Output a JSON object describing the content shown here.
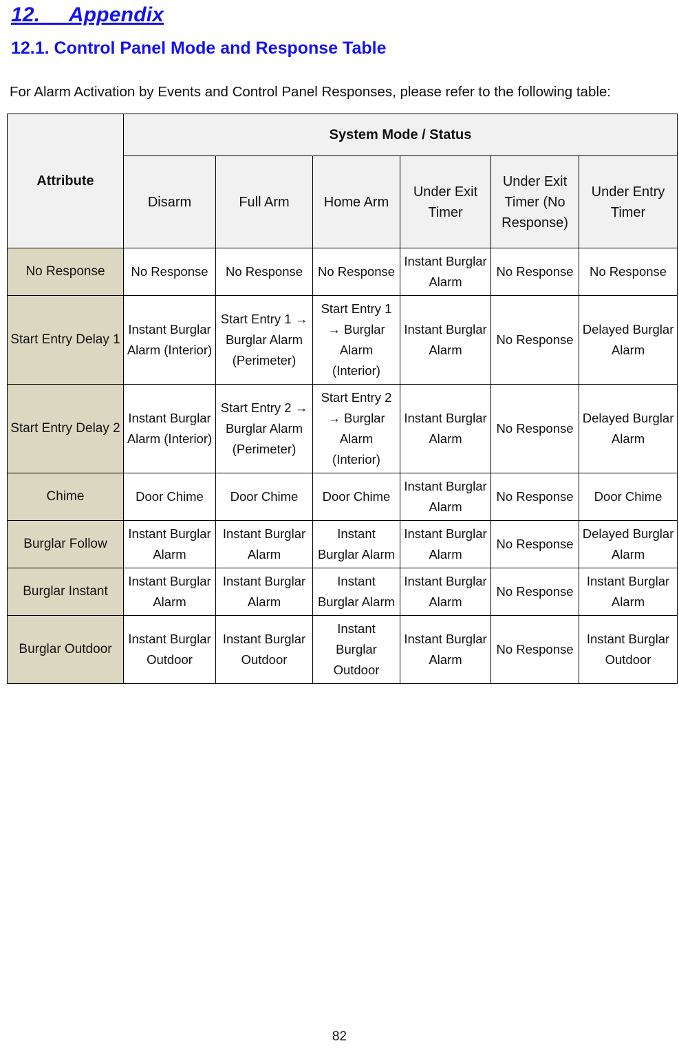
{
  "document": {
    "heading": "12.     Appendix",
    "subheading": "12.1. Control Panel Mode and Response Table",
    "intro_paragraph": "For Alarm Activation by Events and Control Panel Responses, please refer to the following table:",
    "page_number": "82",
    "colors": {
      "heading_blue": "#1313f0",
      "header_fill": "#f1f1f1",
      "attribute_fill": "#dcd7c0",
      "body_text": "#111111",
      "border": "#000000"
    }
  },
  "table": {
    "group_header": "System Mode / Status",
    "attribute_header": "Attribute",
    "columns": [
      "Disarm",
      "Full Arm",
      "Home Arm",
      "Under Exit Timer",
      "Under Exit Timer (No Response)",
      "Under Entry Timer"
    ],
    "rows": [
      {
        "attribute": "No Response",
        "cells": [
          "No Response",
          "No Response",
          "No Response",
          "Instant Burglar Alarm",
          "No Response",
          "No Response"
        ]
      },
      {
        "attribute": "Start Entry Delay 1",
        "cells": [
          "Instant Burglar Alarm (Interior)",
          "Start Entry 1 → Burglar Alarm (Perimeter)",
          "Start Entry 1 → Burglar Alarm (Interior)",
          "Instant Burglar Alarm",
          "No Response",
          "Delayed Burglar Alarm"
        ]
      },
      {
        "attribute": "Start Entry Delay 2",
        "cells": [
          "Instant Burglar Alarm (Interior)",
          "Start Entry 2 → Burglar Alarm (Perimeter)",
          "Start Entry 2 → Burglar Alarm (Interior)",
          "Instant Burglar Alarm",
          "No Response",
          "Delayed Burglar Alarm"
        ]
      },
      {
        "attribute": "Chime",
        "cells": [
          "Door Chime",
          "Door Chime",
          "Door Chime",
          "Instant Burglar Alarm",
          "No Response",
          "Door Chime"
        ]
      },
      {
        "attribute": "Burglar Follow",
        "cells": [
          "Instant Burglar Alarm",
          "Instant Burglar Alarm",
          "Instant Burglar Alarm",
          "Instant Burglar Alarm",
          "No Response",
          "Delayed Burglar Alarm"
        ]
      },
      {
        "attribute": "Burglar Instant",
        "cells": [
          "Instant Burglar Alarm",
          "Instant Burglar Alarm",
          "Instant Burglar Alarm",
          "Instant Burglar Alarm",
          "No Response",
          "Instant Burglar Alarm"
        ]
      },
      {
        "attribute": "Burglar Outdoor",
        "cells": [
          "Instant Burglar Outdoor",
          "Instant Burglar Outdoor",
          "Instant Burglar Outdoor",
          "Instant Burglar Alarm",
          "No Response",
          "Instant Burglar Outdoor"
        ]
      }
    ]
  }
}
